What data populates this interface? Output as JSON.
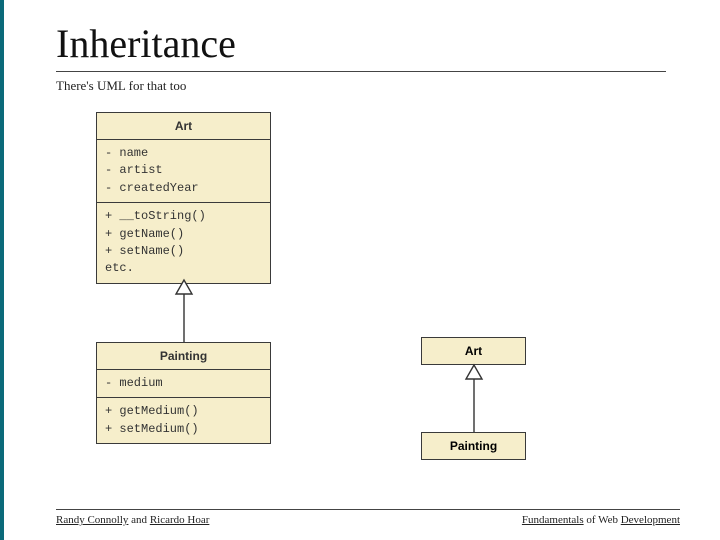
{
  "title": "Inheritance",
  "subtitle": "There's UML for that too",
  "uml": {
    "art": {
      "name": "Art",
      "attrs": [
        "- name",
        "- artist",
        "- createdYear"
      ],
      "ops": [
        "+ __toString()",
        "+ getName()",
        "+ setName()",
        "etc."
      ]
    },
    "painting": {
      "name": "Painting",
      "attrs": [
        "- medium"
      ],
      "ops": [
        "+ getMedium()",
        "+ setMedium()"
      ]
    },
    "simple_art": "Art",
    "simple_painting": "Painting"
  },
  "footer": {
    "left_1": "Randy Connolly",
    "left_mid": " and ",
    "left_2": "Ricardo Hoar",
    "right_1": "Fundamentals",
    "right_mid": " of Web ",
    "right_2": "Development"
  }
}
